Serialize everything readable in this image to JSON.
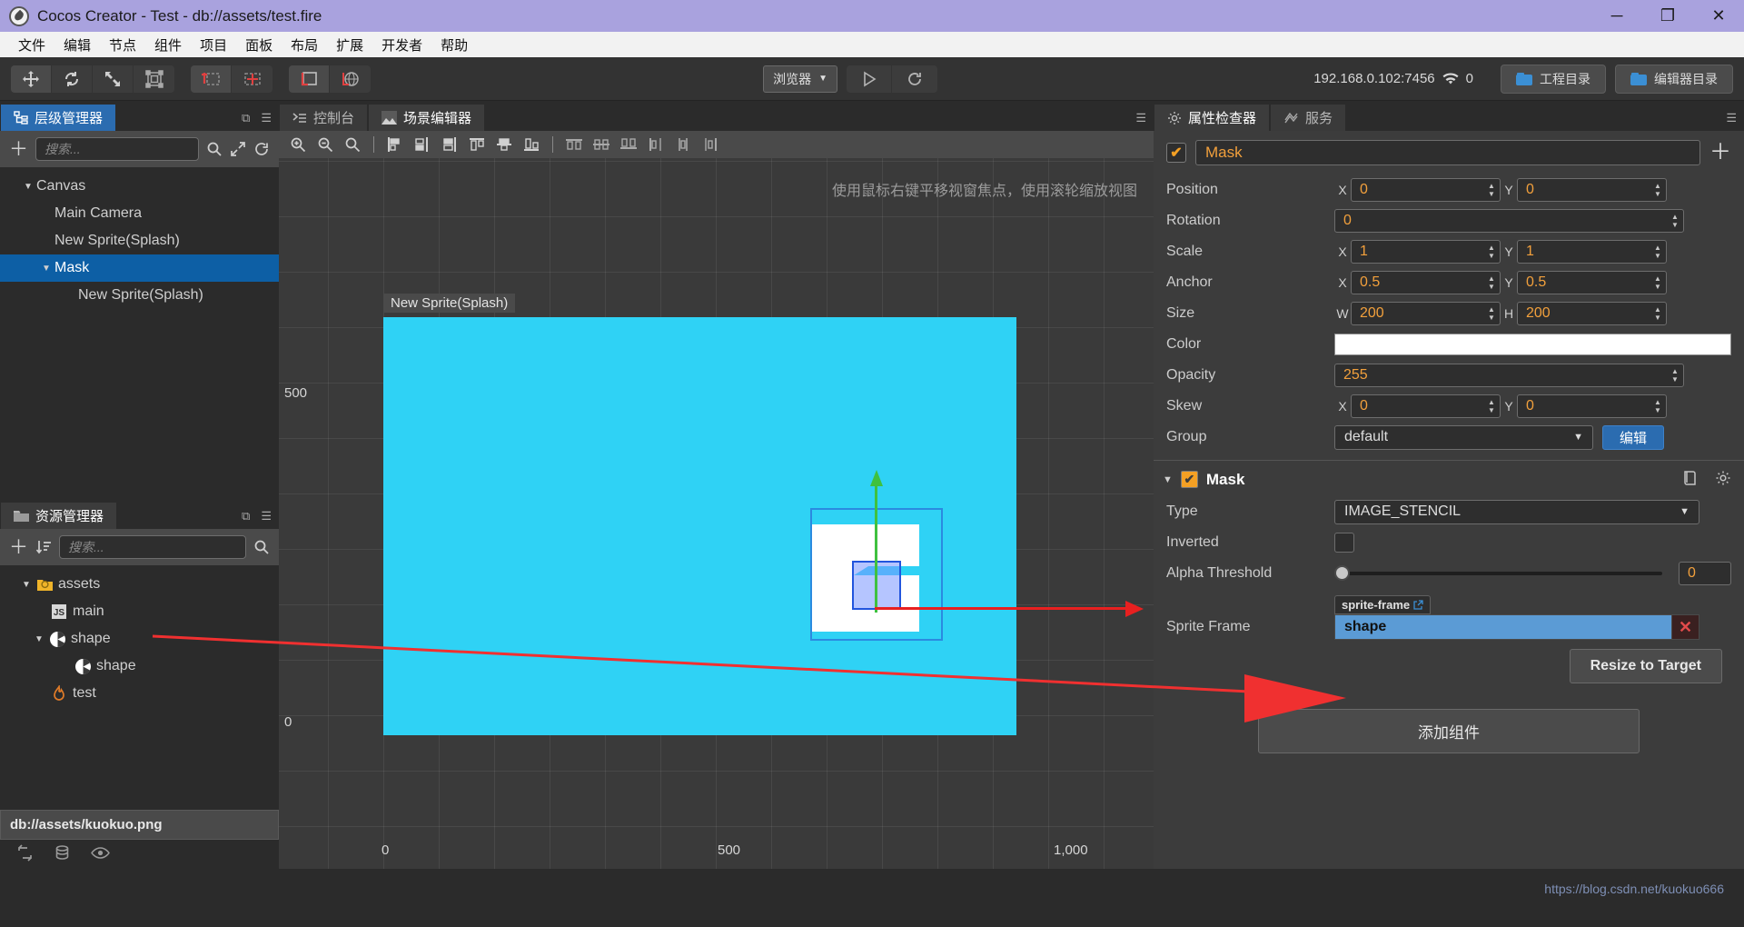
{
  "window": {
    "title": "Cocos Creator - Test - db://assets/test.fire",
    "app_icon": "cocos-logo-icon",
    "minimize": "─",
    "maximize": "❐",
    "close": "✕"
  },
  "menubar": {
    "items": [
      "文件",
      "编辑",
      "节点",
      "组件",
      "项目",
      "面板",
      "布局",
      "扩展",
      "开发者",
      "帮助"
    ]
  },
  "toolbar": {
    "transform_tools": [
      {
        "name": "move-tool",
        "glyph": "✥"
      },
      {
        "name": "rotate-tool",
        "glyph": "↻"
      },
      {
        "name": "scale-tool",
        "glyph": "⤢"
      },
      {
        "name": "rect-tool",
        "glyph": "⧉"
      }
    ],
    "pivot_tools": [
      {
        "name": "pivot-tool",
        "glyph": "⊢"
      },
      {
        "name": "center-tool",
        "glyph": "⋈"
      }
    ],
    "coord_tools": [
      {
        "name": "local-coord-tool",
        "glyph": "∟"
      },
      {
        "name": "global-coord-tool",
        "glyph": "⊕"
      }
    ],
    "preview_target": "浏览器",
    "preview_caret": "▼",
    "play_glyph": "▶",
    "refresh_glyph": "↻",
    "network_address": "192.168.0.102:7456",
    "wifi_icon": "wifi-icon",
    "device_count": "0",
    "project_dir_button": "工程目录",
    "editor_dir_button": "编辑器目录"
  },
  "hierarchy": {
    "tab_label": "层级管理器",
    "tab_icon": "hierarchy-icon",
    "search_placeholder": "搜索...",
    "add_glyph": "＋",
    "search_glyph": "⌕",
    "expand_glyph": "⤡",
    "sync_glyph": "⟳",
    "menu_glyph": "☰",
    "popout_glyph": "⧉",
    "tree": [
      {
        "label": "Canvas",
        "depth": 1,
        "caret": "▼",
        "selected": false
      },
      {
        "label": "Main Camera",
        "depth": 2,
        "caret": "",
        "selected": false
      },
      {
        "label": "New Sprite(Splash)",
        "depth": 2,
        "caret": "",
        "selected": false
      },
      {
        "label": "Mask",
        "depth": 2,
        "caret": "▼",
        "selected": true
      },
      {
        "label": "New Sprite(Splash)",
        "depth": 3,
        "caret": "",
        "selected": false
      }
    ]
  },
  "assets": {
    "tab_label": "资源管理器",
    "tab_icon": "folder-icon",
    "search_placeholder": "搜索...",
    "add_glyph": "＋",
    "sort_glyph": "↓≡",
    "search_glyph": "⌕",
    "popout_glyph": "⧉",
    "menu_glyph": "☰",
    "tree": [
      {
        "label": "assets",
        "depth": 1,
        "caret": "▼",
        "icon": "assets-folder-icon"
      },
      {
        "label": "main",
        "depth": 2,
        "caret": "",
        "icon": "js-file-icon"
      },
      {
        "label": "shape",
        "depth": 2,
        "caret": "▼",
        "icon": "image-asset-icon"
      },
      {
        "label": "shape",
        "depth": 3,
        "caret": "",
        "icon": "sprite-frame-icon"
      },
      {
        "label": "test",
        "depth": 2,
        "caret": "",
        "icon": "fire-scene-icon"
      }
    ],
    "status_path": "db://assets/kuokuo.png",
    "status_icons": [
      "refresh-asset-icon",
      "database-icon",
      "eye-icon"
    ]
  },
  "scene": {
    "tabs": [
      {
        "label": "控制台",
        "icon": "console-icon",
        "active": false
      },
      {
        "label": "场景编辑器",
        "icon": "scene-icon",
        "active": true
      }
    ],
    "menu_glyph": "☰",
    "align_tools": [
      {
        "name": "zoom-in-tool",
        "glyph": "⊕"
      },
      {
        "name": "zoom-out-tool",
        "glyph": "⊖"
      },
      {
        "name": "zoom-fit-tool",
        "glyph": "⌕"
      },
      {
        "name": "separator-1",
        "glyph": "|"
      },
      {
        "name": "align-left-tool",
        "glyph": "⬚"
      },
      {
        "name": "align-center-h-tool",
        "glyph": "⬚"
      },
      {
        "name": "align-right-tool",
        "glyph": "⬚"
      },
      {
        "name": "align-top-tool",
        "glyph": "⬚"
      },
      {
        "name": "align-middle-v-tool",
        "glyph": "⬚"
      },
      {
        "name": "align-bottom-tool",
        "glyph": "⬚"
      },
      {
        "name": "separator-2",
        "glyph": "|"
      },
      {
        "name": "distribute-top-tool",
        "glyph": "⬚"
      },
      {
        "name": "distribute-middle-tool",
        "glyph": "⬚"
      },
      {
        "name": "distribute-bottom-tool",
        "glyph": "⬚"
      },
      {
        "name": "distribute-left-tool",
        "glyph": "⬚"
      },
      {
        "name": "distribute-center-tool",
        "glyph": "⬚"
      },
      {
        "name": "distribute-right-tool",
        "glyph": "⬚"
      }
    ],
    "hint": "使用鼠标右键平移视窗焦点，使用滚轮缩放视图",
    "node_label": "New Sprite(Splash)",
    "ruler_y": [
      "500",
      "0"
    ],
    "ruler_x": [
      "0",
      "500",
      "1,000"
    ],
    "canvas_color": "#2fd2f5"
  },
  "inspector": {
    "tabs": [
      {
        "label": "属性检查器",
        "icon": "gear-icon",
        "active": true
      },
      {
        "label": "服务",
        "icon": "service-icon",
        "active": false
      }
    ],
    "menu_glyph": "☰",
    "node_enabled_check": "✔",
    "node_name": "Mask",
    "add_glyph": "＋",
    "properties": [
      {
        "label": "Position",
        "type": "xy",
        "x": "0",
        "y": "0"
      },
      {
        "label": "Rotation",
        "type": "single",
        "value": "0"
      },
      {
        "label": "Scale",
        "type": "xy",
        "x": "1",
        "y": "1"
      },
      {
        "label": "Anchor",
        "type": "xy",
        "x": "0.5",
        "y": "0.5"
      },
      {
        "label": "Size",
        "type": "wh",
        "w_label": "W",
        "h_label": "H",
        "x": "200",
        "y": "200"
      },
      {
        "label": "Color",
        "type": "color",
        "value": "#ffffff"
      },
      {
        "label": "Opacity",
        "type": "single",
        "value": "255"
      },
      {
        "label": "Skew",
        "type": "xy",
        "x": "0",
        "y": "0"
      },
      {
        "label": "Group",
        "type": "select",
        "value": "default",
        "caret": "▼",
        "button": "编辑"
      }
    ],
    "component": {
      "collapse_caret": "▼",
      "enabled_check": "✔",
      "title": "Mask",
      "help_icon": "help-book-icon",
      "gear_icon": "gear-icon",
      "type_label": "Type",
      "type_value": "IMAGE_STENCIL",
      "type_caret": "▼",
      "inverted_label": "Inverted",
      "alpha_label": "Alpha Threshold",
      "alpha_value": "0",
      "sprite_frame_label": "Sprite Frame",
      "sprite_frame_chip": "sprite-frame",
      "sprite_frame_link_icon": "external-link-icon",
      "sprite_frame_value": "shape",
      "sprite_frame_clear": "✕",
      "resize_button": "Resize to Target"
    },
    "add_component_button": "添加组件"
  },
  "watermark": "https://blog.csdn.net/kuokuo666",
  "colors": {
    "accent_orange": "#f2a03c",
    "select_blue": "#0d5fa5",
    "tab_blue": "#2b6cb0",
    "canvas_cyan": "#2fd2f5",
    "annotation_red": "#f03030",
    "title_purple": "#a9a2de"
  }
}
